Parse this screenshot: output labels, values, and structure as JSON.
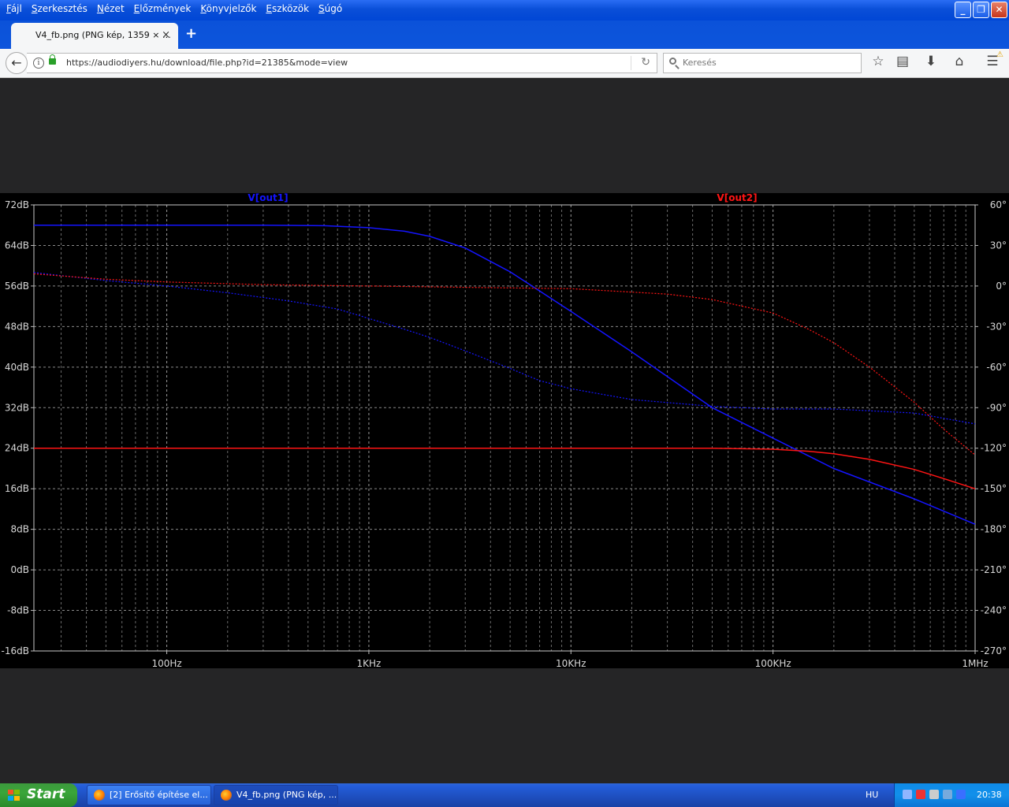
{
  "window": {
    "menu": [
      "Fájl",
      "Szerkesztés",
      "Nézet",
      "Előzmények",
      "Könyvjelzők",
      "Eszközök",
      "Súgó"
    ],
    "buttons": {
      "minimize": "_",
      "restore": "❐",
      "close": "✕"
    }
  },
  "tab": {
    "title": "V4_fb.png (PNG kép, 1359 × …",
    "close": "×",
    "new": "+"
  },
  "nav": {
    "url": "https://audiodiyers.hu/download/file.php?id=21385&mode=view",
    "search_placeholder": "Keresés"
  },
  "chart_data": {
    "type": "line",
    "title": "",
    "x_scale": "log",
    "xlim": [
      22,
      1000000
    ],
    "x_ticks": [
      "100Hz",
      "1KHz",
      "10KHz",
      "100KHz",
      "1MHz"
    ],
    "left_axis": {
      "unit": "dB",
      "ylim": [
        -16,
        72
      ],
      "ticks": [
        "72dB",
        "64dB",
        "56dB",
        "48dB",
        "40dB",
        "32dB",
        "24dB",
        "16dB",
        "8dB",
        "0dB",
        "-8dB",
        "-16dB"
      ]
    },
    "right_axis": {
      "unit": "deg",
      "ylim": [
        -270,
        60
      ],
      "ticks": [
        "60°",
        "30°",
        "0°",
        "-30°",
        "-60°",
        "-90°",
        "-120°",
        "-150°",
        "-180°",
        "-210°",
        "-240°",
        "-270°"
      ]
    },
    "grid": true,
    "series": [
      {
        "name": "V[out1]",
        "color": "#1414ff",
        "magnitude_db": {
          "x": [
            22,
            100,
            300,
            600,
            1000,
            1500,
            2000,
            3000,
            5000,
            7000,
            10000,
            20000,
            50000,
            100000,
            200000,
            500000,
            1000000
          ],
          "y": [
            68,
            68,
            68,
            67.9,
            67.5,
            66.8,
            65.8,
            63.5,
            58.8,
            55,
            51,
            43,
            32,
            26,
            20,
            14,
            9
          ]
        },
        "phase_deg": {
          "x": [
            22,
            50,
            100,
            200,
            400,
            700,
            1000,
            1500,
            2000,
            3000,
            5000,
            7000,
            10000,
            20000,
            50000,
            100000,
            200000,
            500000,
            1000000
          ],
          "y": [
            10,
            4,
            0,
            -5,
            -11,
            -17,
            -24,
            -32,
            -38,
            -48,
            -61,
            -70,
            -76,
            -84,
            -89,
            -91,
            -91,
            -94,
            -102
          ]
        }
      },
      {
        "name": "V[out2]",
        "color": "#ff1414",
        "magnitude_db": {
          "x": [
            22,
            1000,
            10000,
            50000,
            100000,
            150000,
            200000,
            300000,
            500000,
            700000,
            1000000
          ],
          "y": [
            24,
            24,
            24,
            24,
            23.8,
            23.4,
            22.9,
            21.8,
            19.8,
            18,
            16
          ]
        },
        "phase_deg": {
          "x": [
            22,
            50,
            100,
            300,
            1000,
            3000,
            10000,
            30000,
            50000,
            100000,
            150000,
            200000,
            300000,
            500000,
            700000,
            1000000
          ],
          "y": [
            9,
            5,
            3,
            1,
            0,
            -1,
            -2,
            -6,
            -10,
            -20,
            -32,
            -42,
            -60,
            -86,
            -106,
            -125
          ]
        }
      }
    ]
  },
  "taskbar": {
    "start": "Start",
    "tasks": [
      {
        "label": "[2] Erősítő építése el..."
      },
      {
        "label": "V4_fb.png (PNG kép, ..."
      }
    ],
    "language": "HU",
    "clock": "20:38"
  }
}
